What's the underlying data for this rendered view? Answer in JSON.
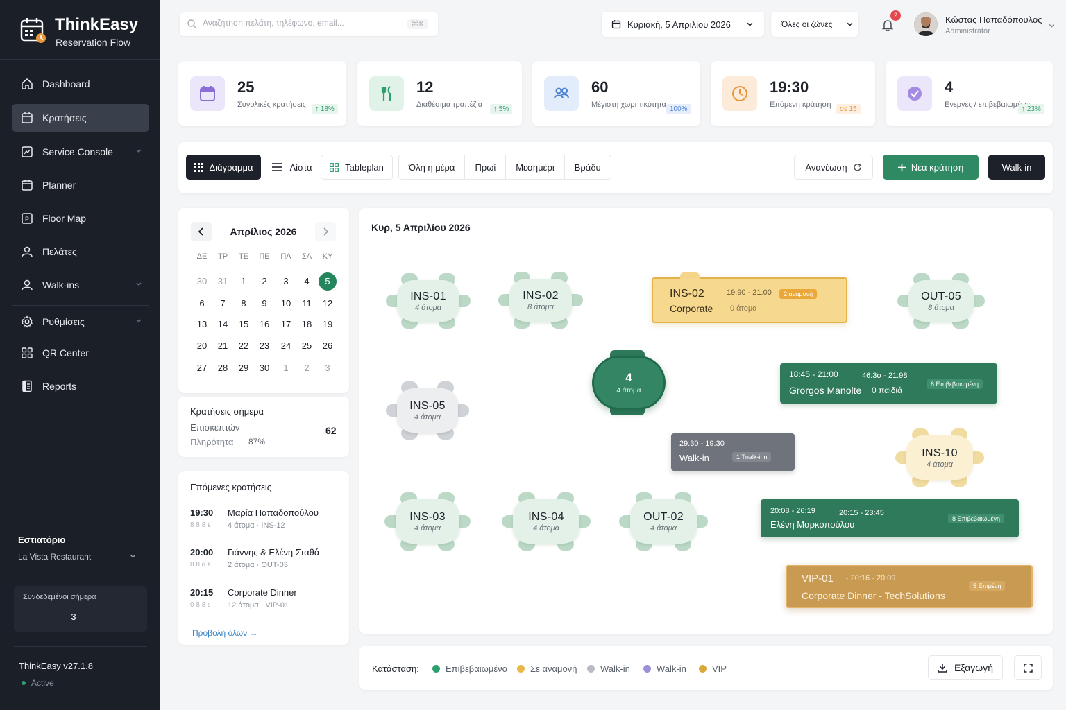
{
  "brand": {
    "title": "ThinkEasy",
    "subtitle": "Reservation Flow"
  },
  "sidebar": {
    "items": [
      {
        "label": "Dashboard",
        "icon": "home-icon"
      },
      {
        "label": "Κρατήσεις",
        "icon": "calendar-icon",
        "active": true
      },
      {
        "label": "Service Console",
        "icon": "monitor-icon"
      },
      {
        "label": "Planner",
        "icon": "calendar-icon"
      },
      {
        "label": "Floor Map",
        "icon": "map-icon"
      },
      {
        "label": "Πελάτες",
        "icon": "user-icon"
      },
      {
        "label": "Walk-ins",
        "icon": "user-icon"
      },
      {
        "label": "Ρυθμίσεις",
        "icon": "gear-icon"
      },
      {
        "label": "QR Center",
        "icon": "qr-icon"
      },
      {
        "label": "Reports",
        "icon": "report-icon"
      }
    ],
    "restaurant_label": "Εστιατόριο",
    "restaurant_name": "La Vista Restaurant",
    "online_label": "Συνδεδεμένοι σήμερα",
    "online_value": "3",
    "version": "ThinkEasy v27.1.8",
    "status": "Active"
  },
  "topbar": {
    "search_placeholder": "Αναζήτηση πελάτη, τηλέφωνο, email...",
    "search_shortcut": "⌘K",
    "date": "Κυριακή, 5 Απριλίου 2026",
    "zones": "Όλες οι ζώνες",
    "notifications": "2",
    "user_name": "Κώστας Παπαδόπουλος",
    "user_role": "Administrator"
  },
  "stats": [
    {
      "value": "25",
      "label": "Συνολικές κρατήσεις",
      "trend": "↑ 18%",
      "color": "#8b6fd6"
    },
    {
      "value": "12",
      "label": "Διαθέσιμα τραπέζια",
      "trend": "↑ 5%",
      "color": "#2f9f6e"
    },
    {
      "value": "60",
      "label": "Μέγιστη χωρητικότητα",
      "trend": "100%",
      "color": "#4a7fd6"
    },
    {
      "value": "19:30",
      "label": "Επόμενη κράτηση",
      "trend": "σε 15",
      "color": "#e8963a"
    },
    {
      "value": "4",
      "label": "Ενεργές / επιβεβαιωμένες",
      "trend": "↑ 23%",
      "color": "#8b6fd6"
    }
  ],
  "toolbar": {
    "view_diagram": "Διάγραμμα",
    "view_list": "Λίστα",
    "view_tableplan": "Tableplan",
    "periods": [
      "Όλη η μέρα",
      "Πρωί",
      "Μεσημέρι",
      "Βράδυ"
    ],
    "refresh": "Ανανέωση",
    "new_reservation": "Νέα κράτηση",
    "walkin": "Walk-in"
  },
  "calendar": {
    "title": "Απρίλιος 2026",
    "weekdays": [
      "ΔΕ",
      "ΤΡ",
      "ΤΕ",
      "ΠΕ",
      "ΠΑ",
      "ΣΑ",
      "ΚΥ"
    ],
    "weeks": [
      [
        "30",
        "31",
        "1",
        "2",
        "3",
        "4",
        "5"
      ],
      [
        "6",
        "7",
        "8",
        "9",
        "10",
        "11",
        "12"
      ],
      [
        "13",
        "14",
        "15",
        "16",
        "17",
        "18",
        "19"
      ],
      [
        "20",
        "21",
        "22",
        "23",
        "24",
        "25",
        "26"
      ],
      [
        "27",
        "28",
        "29",
        "30",
        "1",
        "2",
        "3"
      ]
    ],
    "selected": "5"
  },
  "today": {
    "title": "Κρατήσεις σήμερα",
    "visitors_label": "Επισκεπτών",
    "visitors_value": "62",
    "fill_label": "Πληρότητα",
    "fill_value": "87%"
  },
  "upcoming": {
    "title": "Επόμενες κρατήσεις",
    "items": [
      {
        "time": "19:30",
        "sub": "8 8 8 ε",
        "name": "Μαρία Παπαδοπούλου",
        "detail": "4 άτομα · INS-12"
      },
      {
        "time": "20:00",
        "sub": "8 8 α ε",
        "name": "Γιάννης & Ελένη Σταθά",
        "detail": "2 άτομα · OUT-03"
      },
      {
        "time": "20:15",
        "sub": "0 8 8 ε",
        "name": "Corporate Dinner",
        "detail": "12 άτομα · VIP-01"
      }
    ],
    "view_all": "Προβολή όλων →"
  },
  "floor": {
    "title": "Κυρ, 5 Απριλίου 2026",
    "tables": [
      {
        "name": "INS-01",
        "seats": "4 άτομα"
      },
      {
        "name": "INS-02",
        "seats": "8 άτομα"
      },
      {
        "name": "OUT-05",
        "seats": "8 άτομα"
      },
      {
        "name": "INS-05",
        "seats": "4 άτομα"
      },
      {
        "name": "4",
        "seats": "4 άτομα"
      },
      {
        "name": "INS-10",
        "seats": "4 άτομα"
      },
      {
        "name": "INS-03",
        "seats": "4 άτομα"
      },
      {
        "name": "INS-04",
        "seats": "4 άτομα"
      },
      {
        "name": "OUT-02",
        "seats": "4 άτομα"
      }
    ],
    "bars": [
      {
        "line1": "INS-02",
        "line2": "Corporate",
        "time": "19:90 - 21:00",
        "people": "0 άτομα",
        "pill": "2 αναμονή"
      },
      {
        "time": "18:45 - 21:00",
        "time2": "46:3σ - 21:98",
        "name": "Grorgos Manolte",
        "people": "0 παιδιά",
        "pill": "6 Επιβεβαιωμένη"
      },
      {
        "time": "29:30 - 19:30",
        "name": "Walk-in",
        "pill": "1 Tnalk-inn"
      },
      {
        "time": "20:08 - 26:19",
        "time2": "20:15 - 23:45",
        "name": "Ελένη Μαρκοπούλου",
        "pill": "8 Επιβεβαιωμένη"
      },
      {
        "name": "VIP-01",
        "time": "|- 20:16 - 20:09",
        "detail": "Corporate Dinner - TechSolutions",
        "pill": "5 Επιμένη"
      }
    ]
  },
  "legend": {
    "label": "Κατάσταση:",
    "items": [
      {
        "label": "Επιβεβαιωμένο",
        "color": "#2f9f6e"
      },
      {
        "label": "Σε αναμονή",
        "color": "#e8b84a"
      },
      {
        "label": "Walk-in",
        "color": "#b8bcc2"
      },
      {
        "label": "Walk-in",
        "color": "#9b8fd6"
      },
      {
        "label": "VIP",
        "color": "#d9a93a"
      }
    ],
    "export": "Εξαγωγή"
  }
}
